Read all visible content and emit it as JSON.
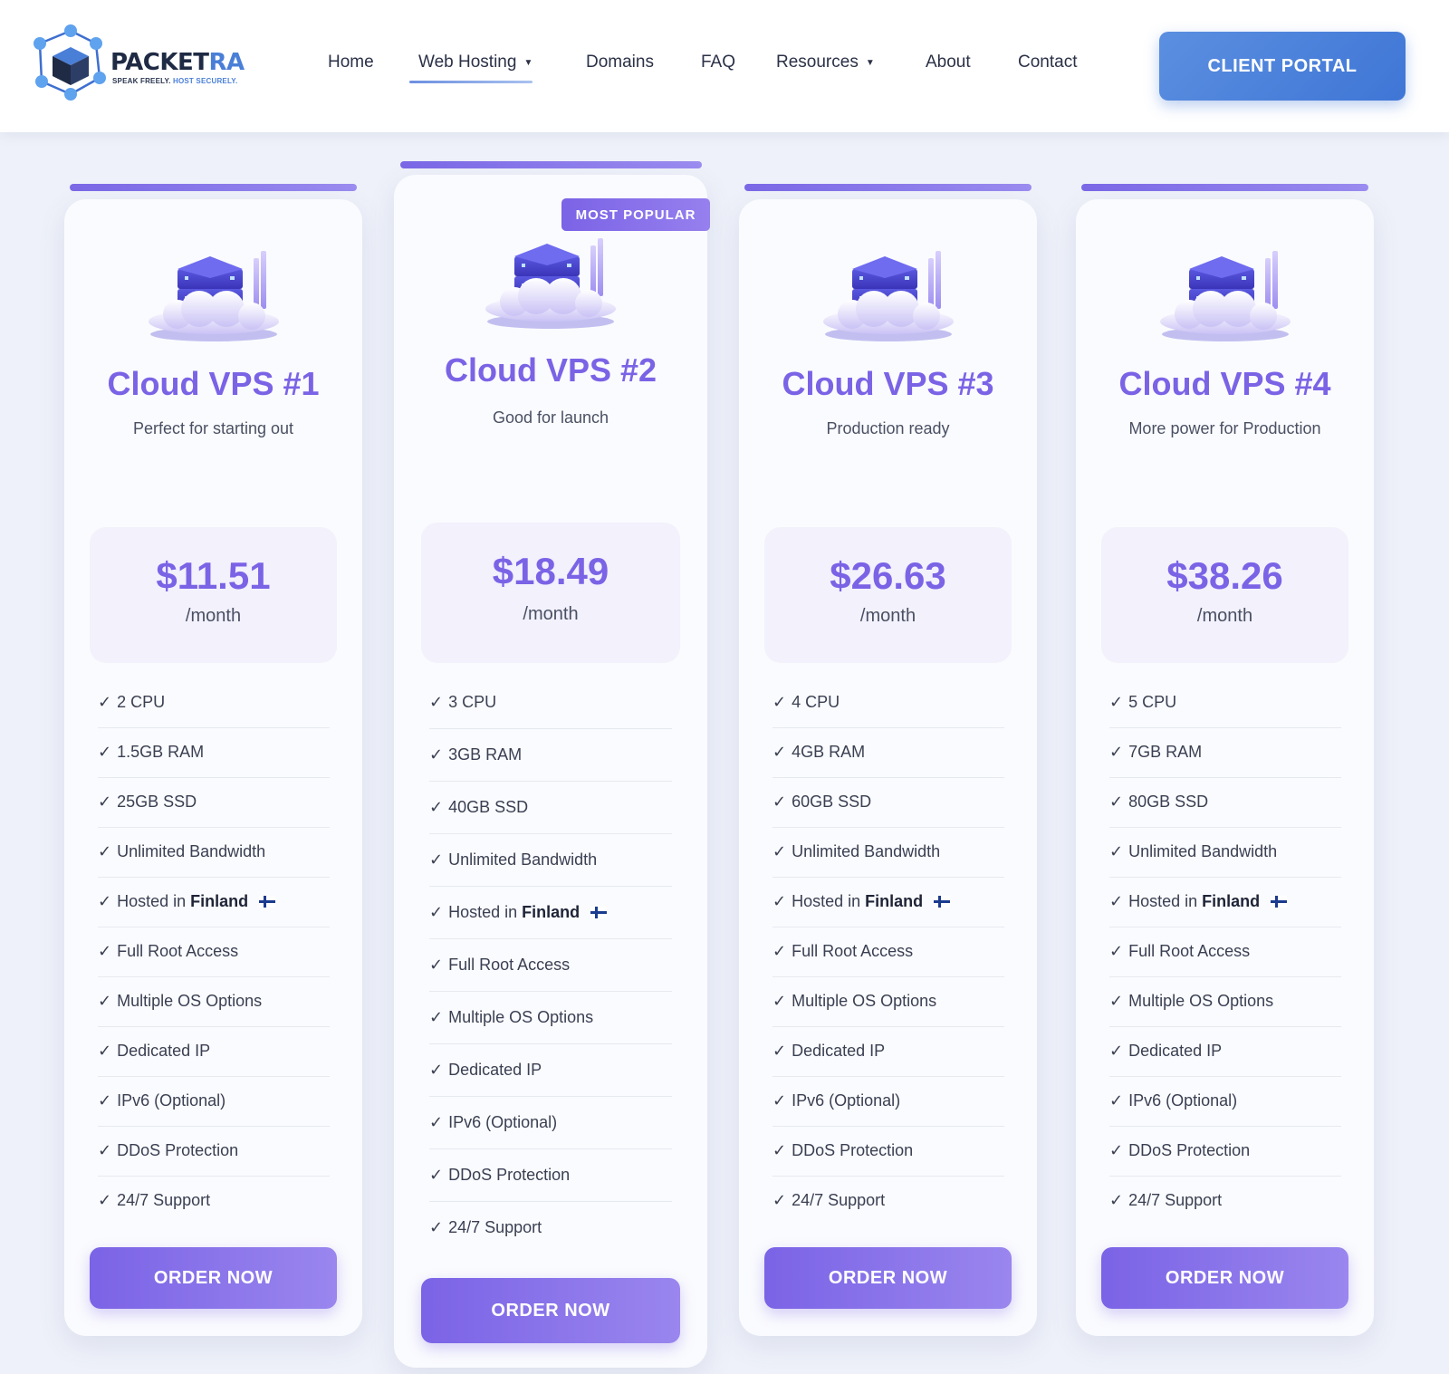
{
  "brand": {
    "name_part1": "PACKET",
    "name_part2": "RA",
    "tagline_part1": "SPEAK FREELY.",
    "tagline_part2": " HOST SECURELY."
  },
  "nav": {
    "items": [
      {
        "label": "Home"
      },
      {
        "label": "Web Hosting",
        "dropdown": true,
        "active": true
      },
      {
        "label": "Domains"
      },
      {
        "label": "FAQ"
      },
      {
        "label": "Resources",
        "dropdown": true
      },
      {
        "label": "About"
      },
      {
        "label": "Contact"
      }
    ],
    "cta_label": "CLIENT PORTAL"
  },
  "colors": {
    "accent": "#7b63e6",
    "brand_blue": "#4a7fd8",
    "background": "#eef1f9"
  },
  "icons": {
    "caret": "caret-down-icon",
    "check": "checkmark",
    "flag": "finland-flag-icon",
    "illustration": "cloud-server-icon"
  },
  "plans": [
    {
      "name": "Cloud VPS #1",
      "subtitle": "Perfect for starting out",
      "price": "$11.51",
      "period": "/month",
      "features": [
        "2 CPU",
        "1.5GB RAM",
        "25GB SSD",
        "Unlimited Bandwidth",
        "Hosted in",
        "Full Root Access",
        "Multiple OS Options",
        "Dedicated IP",
        "IPv6 (Optional)",
        "DDoS Protection",
        "24/7 Support"
      ],
      "location": "Finland",
      "order_label": "ORDER NOW"
    },
    {
      "name": "Cloud VPS #2",
      "subtitle": "Good for launch",
      "badge": "MOST POPULAR",
      "price": "$18.49",
      "period": "/month",
      "features": [
        "3 CPU",
        "3GB RAM",
        "40GB SSD",
        "Unlimited Bandwidth",
        "Hosted in",
        "Full Root Access",
        "Multiple OS Options",
        "Dedicated IP",
        "IPv6 (Optional)",
        "DDoS Protection",
        "24/7 Support"
      ],
      "location": "Finland",
      "order_label": "ORDER NOW"
    },
    {
      "name": "Cloud VPS #3",
      "subtitle": "Production ready",
      "price": "$26.63",
      "period": "/month",
      "features": [
        "4 CPU",
        "4GB RAM",
        "60GB SSD",
        "Unlimited Bandwidth",
        "Hosted in",
        "Full Root Access",
        "Multiple OS Options",
        "Dedicated IP",
        "IPv6 (Optional)",
        "DDoS Protection",
        "24/7 Support"
      ],
      "location": "Finland",
      "order_label": "ORDER NOW"
    },
    {
      "name": "Cloud VPS #4",
      "subtitle": "More power for Production",
      "price": "$38.26",
      "period": "/month",
      "features": [
        "5 CPU",
        "7GB RAM",
        "80GB SSD",
        "Unlimited Bandwidth",
        "Hosted in",
        "Full Root Access",
        "Multiple OS Options",
        "Dedicated IP",
        "IPv6 (Optional)",
        "DDoS Protection",
        "24/7 Support"
      ],
      "location": "Finland",
      "order_label": "ORDER NOW"
    }
  ]
}
